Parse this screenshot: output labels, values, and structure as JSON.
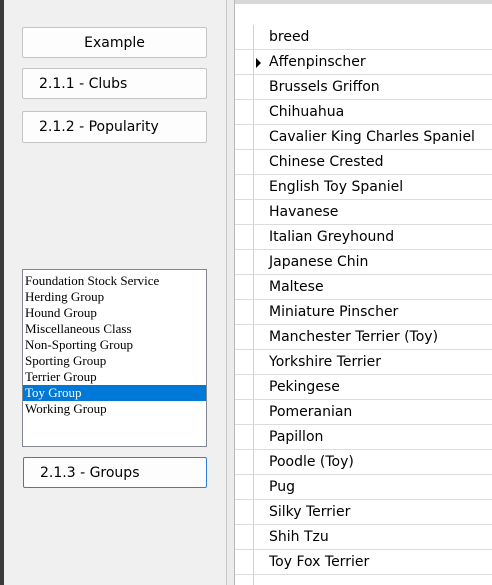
{
  "buttons": {
    "example": "Example",
    "clubs": "2.1.1 -  Clubs",
    "popularity": "2.1.2 - Popularity",
    "groups": "2.1.3 - Groups"
  },
  "group_list": {
    "items": [
      "Foundation Stock Service",
      "Herding Group",
      "Hound Group",
      "Miscellaneous Class",
      "Non-Sporting Group",
      "Sporting Group",
      "Terrier Group",
      "Toy Group",
      "Working Group"
    ],
    "selected": "Toy Group"
  },
  "grid": {
    "header": "breed",
    "current_row_indicator": "triangle-right-icon",
    "rows": [
      "Affenpinscher",
      "Brussels Griffon",
      "Chihuahua",
      "Cavalier King Charles Spaniel",
      "Chinese Crested",
      "English Toy Spaniel",
      "Havanese",
      "Italian Greyhound",
      "Japanese Chin",
      "Maltese",
      "Miniature Pinscher",
      "Manchester Terrier (Toy)",
      "Yorkshire Terrier",
      "Pekingese",
      "Pomeranian",
      "Papillon",
      "Poodle (Toy)",
      "Pug",
      "Silky Terrier",
      "Shih Tzu",
      "Toy Fox Terrier"
    ]
  },
  "colors": {
    "selection": "#0078d7",
    "focus_border": "#2f7fd6",
    "panel_background": "#f0f0f0"
  }
}
